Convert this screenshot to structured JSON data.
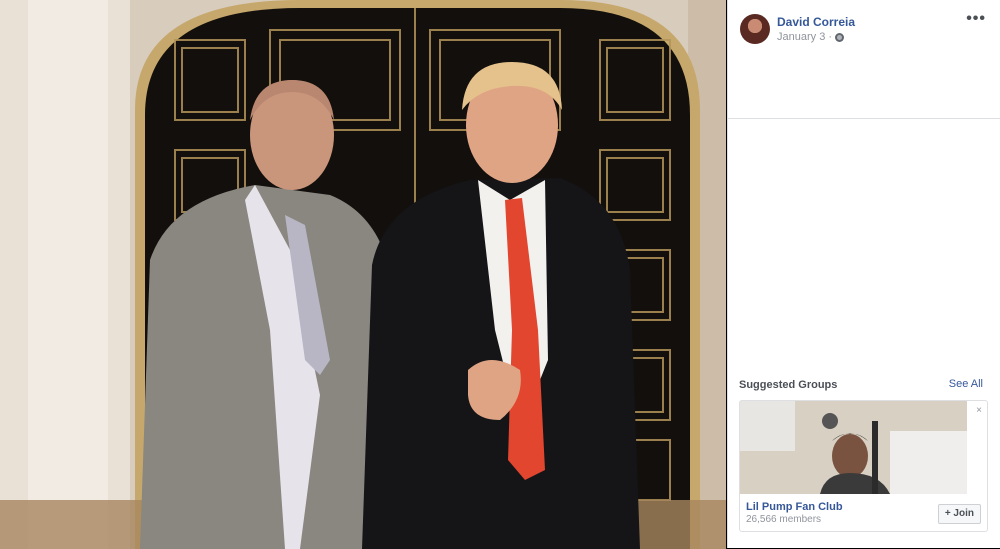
{
  "post": {
    "author": "David Correia",
    "date": "January 3",
    "separator": "·",
    "privacy_icon": "globe-icon",
    "more_icon": "ellipsis-icon",
    "more_label": "•••"
  },
  "suggested_groups": {
    "title": "Suggested Groups",
    "see_all": "See All",
    "close_label": "×",
    "group": {
      "name": "Lil Pump Fan Club",
      "members": "26,566 members",
      "join_label": "+ Join"
    }
  },
  "colors": {
    "link": "#365899",
    "muted": "#90949c",
    "border": "#dddfe2"
  }
}
